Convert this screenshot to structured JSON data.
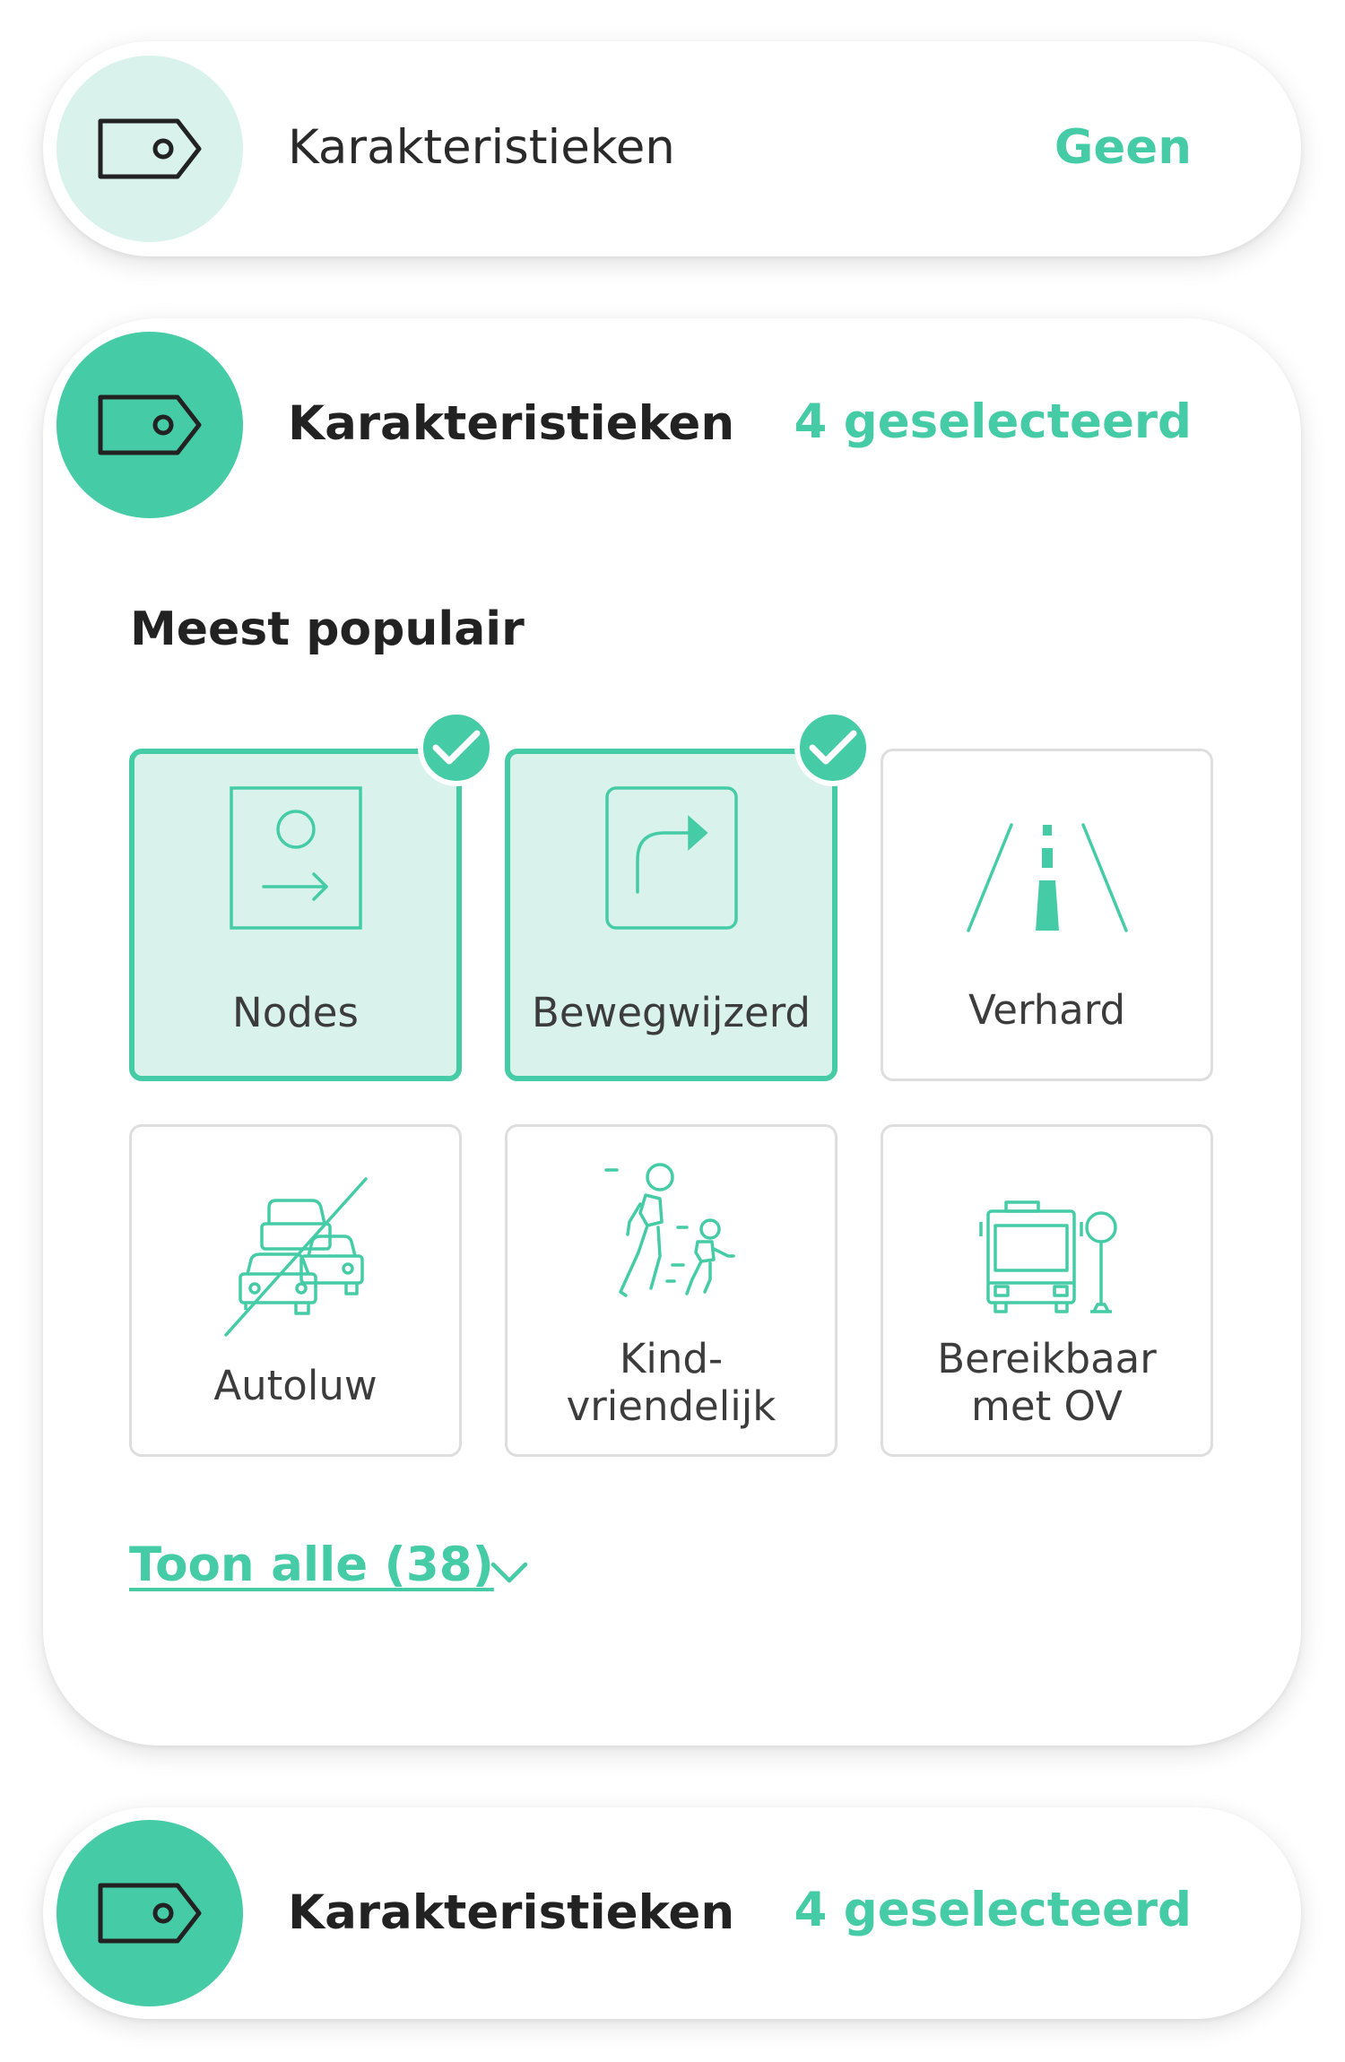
{
  "panels": [
    {
      "title": "Karakteristieken",
      "value": "Geen",
      "icon": "tag-icon",
      "state": "collapsed-empty"
    },
    {
      "title": "Karakteristieken",
      "value": "4 geselecteerd",
      "icon": "tag-icon",
      "state": "expanded"
    },
    {
      "title": "Karakteristieken",
      "value": "4 geselecteerd",
      "icon": "tag-icon",
      "state": "collapsed-selected"
    }
  ],
  "expanded": {
    "section_title": "Meest populair",
    "options": [
      {
        "label": "Nodes",
        "icon": "nodes-icon",
        "selected": true
      },
      {
        "label": "Bewegwijzerd",
        "icon": "signposted-icon",
        "selected": true
      },
      {
        "label": "Verhard",
        "icon": "paved-road-icon",
        "selected": false
      },
      {
        "label": "Autoluw",
        "icon": "car-free-icon",
        "selected": false
      },
      {
        "label": "Kind-\nvriendelijk",
        "icon": "child-friendly-icon",
        "selected": false
      },
      {
        "label": "Bereikbaar\nmet OV",
        "icon": "public-transport-icon",
        "selected": false
      }
    ],
    "show_all_label": "Toon alle (38)"
  },
  "colors": {
    "accent": "#45cca6",
    "accent_light": "#d9f3ec",
    "text": "#222222",
    "border": "#dedede"
  }
}
